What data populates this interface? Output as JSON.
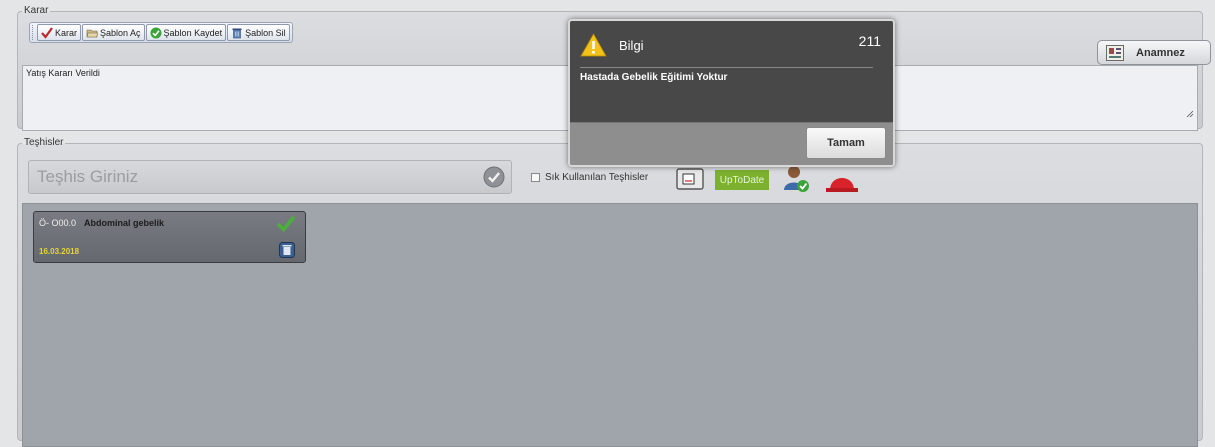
{
  "karar": {
    "legend": "Karar",
    "toolbar": {
      "karar_label": "Karar",
      "sablon_ac_label": "Şablon Aç",
      "sablon_kaydet_label": "Şablon Kaydet",
      "sablon_sil_label": "Şablon Sil"
    },
    "text_value": "Yatış Kararı Verildi",
    "anamnez_label": "Anamnez"
  },
  "teshisler": {
    "legend": "Teşhisler",
    "input_placeholder": "Teşhis Giriniz",
    "sik_kullanilan_label": "Sık Kullanılan Teşhisler",
    "update_label": "UpToDate",
    "items": [
      {
        "code": "Ö- O00.0",
        "name": "Abdominal gebelik",
        "date": "16.03.2018"
      }
    ]
  },
  "dialog": {
    "title": "Bilgi",
    "number": "211",
    "message": "Hastada Gebelik Eğitimi Yoktur",
    "ok_label": "Tamam"
  },
  "icons": {
    "warning": "warning-triangle-icon",
    "check": "check-icon",
    "trash": "trash-icon",
    "anamnez": "patient-record-icon"
  },
  "colors": {
    "update_green": "#7bb12f",
    "date_yellow": "#e8d33a",
    "dialog_bg": "#484848"
  }
}
